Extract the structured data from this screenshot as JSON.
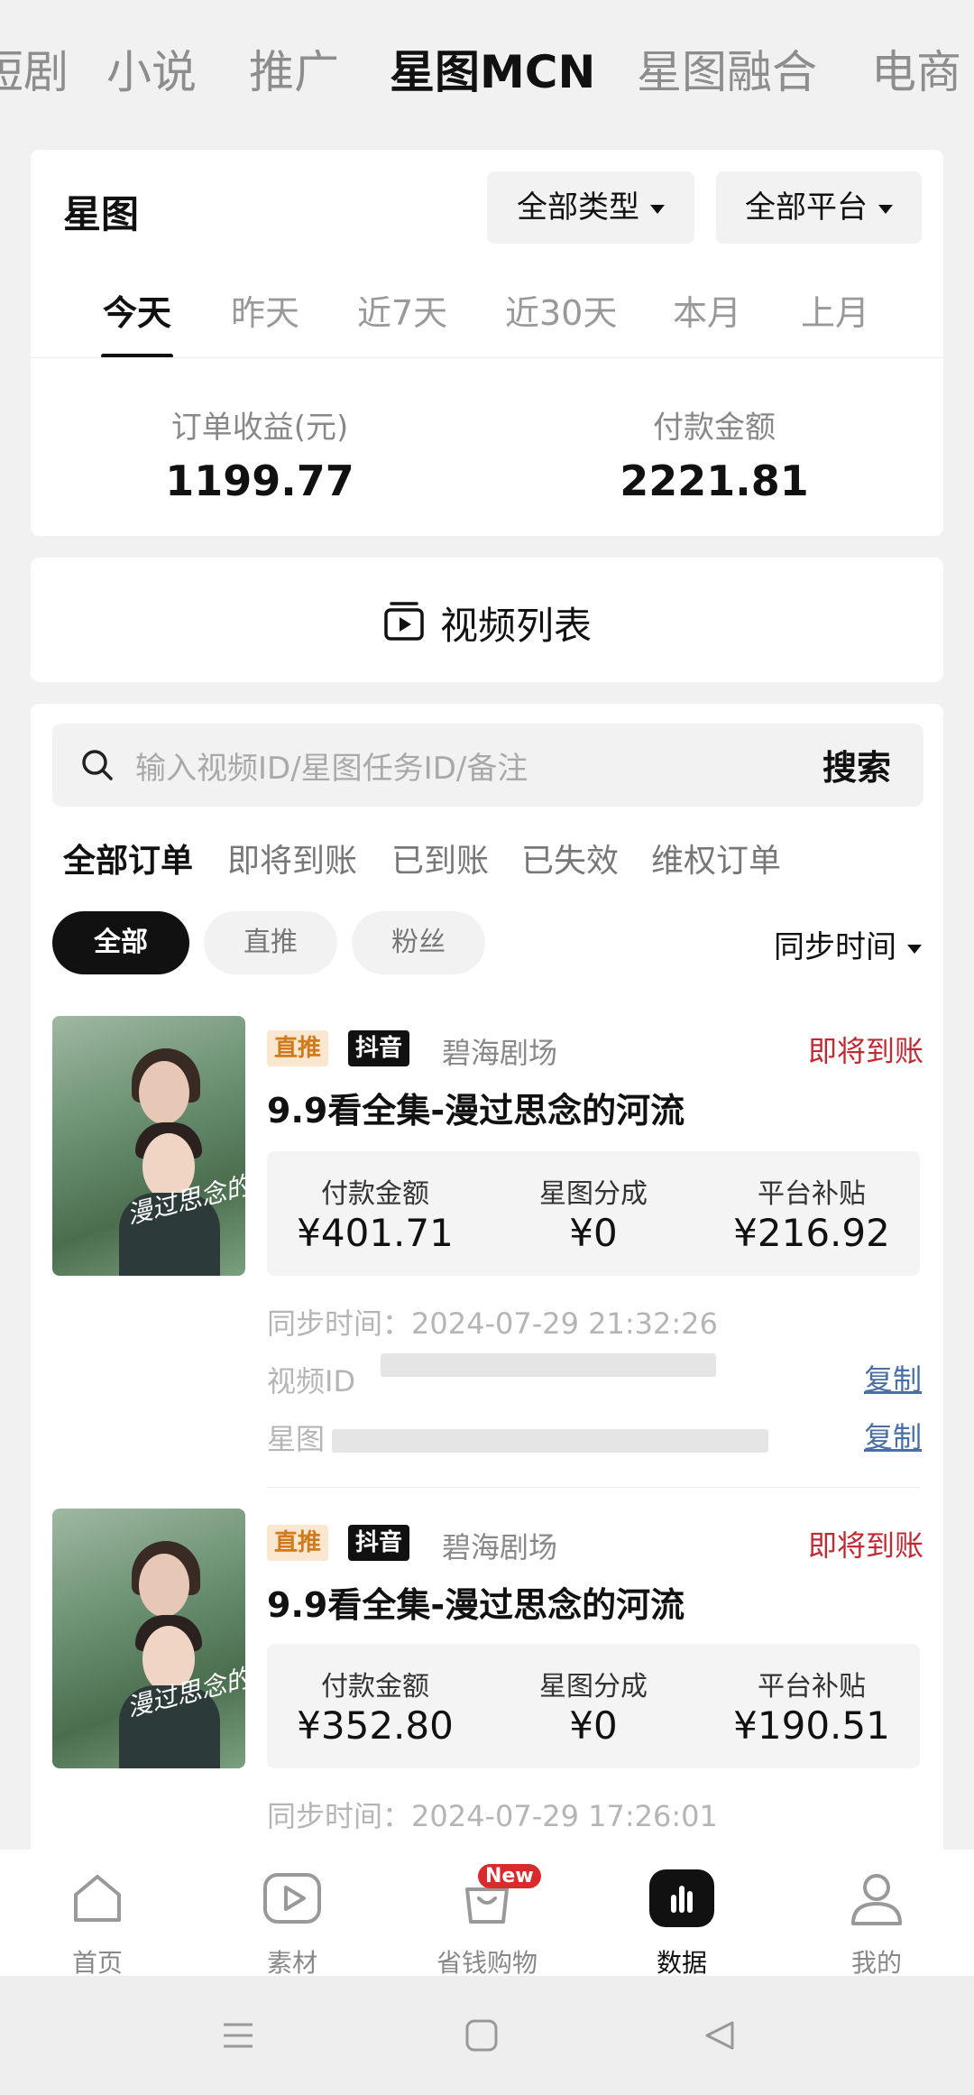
{
  "top_tabs": [
    {
      "label": "短剧",
      "active": false
    },
    {
      "label": "小说",
      "active": false
    },
    {
      "label": "推广",
      "active": false
    },
    {
      "label": "星图MCN",
      "active": true
    },
    {
      "label": "星图融合",
      "active": false
    },
    {
      "label": "电商",
      "active": false
    }
  ],
  "summary": {
    "title": "星图",
    "type_filter": "全部类型",
    "platform_filter": "全部平台",
    "periods": [
      "今天",
      "昨天",
      "近7天",
      "近30天",
      "本月",
      "上月"
    ],
    "active_period": "今天",
    "stats": [
      {
        "label": "订单收益(元)",
        "value": "1199.77"
      },
      {
        "label": "付款金额",
        "value": "2221.81"
      }
    ]
  },
  "video_list": {
    "label": "视频列表",
    "icon": "video-list-icon"
  },
  "search": {
    "placeholder": "输入视频ID/星图任务ID/备注",
    "button": "搜索"
  },
  "order_tabs": [
    "全部订单",
    "即将到账",
    "已到账",
    "已失效",
    "维权订单"
  ],
  "filter_chips": [
    "全部",
    "直推",
    "粉丝"
  ],
  "sort_label": "同步时间",
  "orders": [
    {
      "tag_type": "直推",
      "tag_platform": "抖音",
      "store": "碧海剧场",
      "status": "即将到账",
      "title": "9.9看全集-漫过思念的河流",
      "metrics": [
        {
          "label": "付款金额",
          "value": "¥401.71"
        },
        {
          "label": "星图分成",
          "value": "¥0"
        },
        {
          "label": "平台补贴",
          "value": "¥216.92"
        }
      ],
      "sync_time": "同步时间：2024-07-29 21:32:26",
      "video_id_label": "视频ID",
      "task_id_label": "星图",
      "copy_label": "复制",
      "poster_caption": "漫过思念的河流"
    },
    {
      "tag_type": "直推",
      "tag_platform": "抖音",
      "store": "碧海剧场",
      "status": "即将到账",
      "title": "9.9看全集-漫过思念的河流",
      "metrics": [
        {
          "label": "付款金额",
          "value": "¥352.80"
        },
        {
          "label": "星图分成",
          "value": "¥0"
        },
        {
          "label": "平台补贴",
          "value": "¥190.51"
        }
      ],
      "sync_time": "同步时间：2024-07-29 17:26:01",
      "poster_caption": "漫过思念的河流"
    }
  ],
  "bottom_nav": [
    {
      "label": "首页",
      "icon": "home-icon",
      "active": false
    },
    {
      "label": "素材",
      "icon": "play-icon",
      "active": false
    },
    {
      "label": "省钱购物",
      "icon": "shopping-bag-icon",
      "active": false,
      "badge": "New"
    },
    {
      "label": "数据",
      "icon": "bar-chart-icon",
      "active": true
    },
    {
      "label": "我的",
      "icon": "profile-icon",
      "active": false
    }
  ],
  "colors": {
    "accent": "#111111",
    "status_red": "#c22a33",
    "link_blue": "#4a6fa5",
    "tag_orange": "#d07a1e"
  }
}
